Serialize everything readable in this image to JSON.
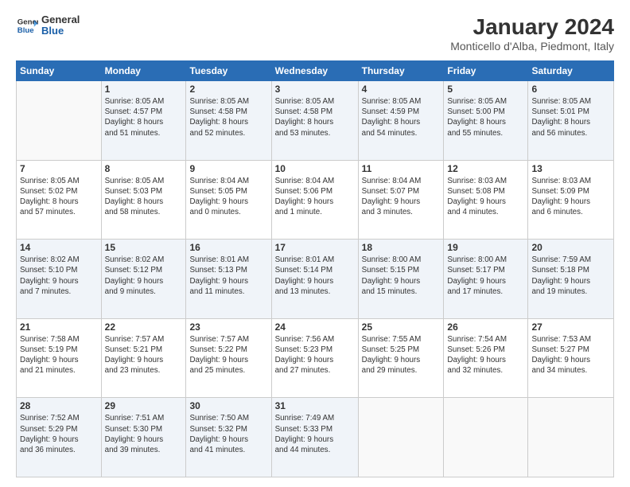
{
  "logo": {
    "line1": "General",
    "line2": "Blue"
  },
  "title": "January 2024",
  "subtitle": "Monticello d'Alba, Piedmont, Italy",
  "days_of_week": [
    "Sunday",
    "Monday",
    "Tuesday",
    "Wednesday",
    "Thursday",
    "Friday",
    "Saturday"
  ],
  "weeks": [
    [
      {
        "day": "",
        "content": ""
      },
      {
        "day": "1",
        "content": "Sunrise: 8:05 AM\nSunset: 4:57 PM\nDaylight: 8 hours\nand 51 minutes."
      },
      {
        "day": "2",
        "content": "Sunrise: 8:05 AM\nSunset: 4:58 PM\nDaylight: 8 hours\nand 52 minutes."
      },
      {
        "day": "3",
        "content": "Sunrise: 8:05 AM\nSunset: 4:58 PM\nDaylight: 8 hours\nand 53 minutes."
      },
      {
        "day": "4",
        "content": "Sunrise: 8:05 AM\nSunset: 4:59 PM\nDaylight: 8 hours\nand 54 minutes."
      },
      {
        "day": "5",
        "content": "Sunrise: 8:05 AM\nSunset: 5:00 PM\nDaylight: 8 hours\nand 55 minutes."
      },
      {
        "day": "6",
        "content": "Sunrise: 8:05 AM\nSunset: 5:01 PM\nDaylight: 8 hours\nand 56 minutes."
      }
    ],
    [
      {
        "day": "7",
        "content": "Sunrise: 8:05 AM\nSunset: 5:02 PM\nDaylight: 8 hours\nand 57 minutes."
      },
      {
        "day": "8",
        "content": "Sunrise: 8:05 AM\nSunset: 5:03 PM\nDaylight: 8 hours\nand 58 minutes."
      },
      {
        "day": "9",
        "content": "Sunrise: 8:04 AM\nSunset: 5:05 PM\nDaylight: 9 hours\nand 0 minutes."
      },
      {
        "day": "10",
        "content": "Sunrise: 8:04 AM\nSunset: 5:06 PM\nDaylight: 9 hours\nand 1 minute."
      },
      {
        "day": "11",
        "content": "Sunrise: 8:04 AM\nSunset: 5:07 PM\nDaylight: 9 hours\nand 3 minutes."
      },
      {
        "day": "12",
        "content": "Sunrise: 8:03 AM\nSunset: 5:08 PM\nDaylight: 9 hours\nand 4 minutes."
      },
      {
        "day": "13",
        "content": "Sunrise: 8:03 AM\nSunset: 5:09 PM\nDaylight: 9 hours\nand 6 minutes."
      }
    ],
    [
      {
        "day": "14",
        "content": "Sunrise: 8:02 AM\nSunset: 5:10 PM\nDaylight: 9 hours\nand 7 minutes."
      },
      {
        "day": "15",
        "content": "Sunrise: 8:02 AM\nSunset: 5:12 PM\nDaylight: 9 hours\nand 9 minutes."
      },
      {
        "day": "16",
        "content": "Sunrise: 8:01 AM\nSunset: 5:13 PM\nDaylight: 9 hours\nand 11 minutes."
      },
      {
        "day": "17",
        "content": "Sunrise: 8:01 AM\nSunset: 5:14 PM\nDaylight: 9 hours\nand 13 minutes."
      },
      {
        "day": "18",
        "content": "Sunrise: 8:00 AM\nSunset: 5:15 PM\nDaylight: 9 hours\nand 15 minutes."
      },
      {
        "day": "19",
        "content": "Sunrise: 8:00 AM\nSunset: 5:17 PM\nDaylight: 9 hours\nand 17 minutes."
      },
      {
        "day": "20",
        "content": "Sunrise: 7:59 AM\nSunset: 5:18 PM\nDaylight: 9 hours\nand 19 minutes."
      }
    ],
    [
      {
        "day": "21",
        "content": "Sunrise: 7:58 AM\nSunset: 5:19 PM\nDaylight: 9 hours\nand 21 minutes."
      },
      {
        "day": "22",
        "content": "Sunrise: 7:57 AM\nSunset: 5:21 PM\nDaylight: 9 hours\nand 23 minutes."
      },
      {
        "day": "23",
        "content": "Sunrise: 7:57 AM\nSunset: 5:22 PM\nDaylight: 9 hours\nand 25 minutes."
      },
      {
        "day": "24",
        "content": "Sunrise: 7:56 AM\nSunset: 5:23 PM\nDaylight: 9 hours\nand 27 minutes."
      },
      {
        "day": "25",
        "content": "Sunrise: 7:55 AM\nSunset: 5:25 PM\nDaylight: 9 hours\nand 29 minutes."
      },
      {
        "day": "26",
        "content": "Sunrise: 7:54 AM\nSunset: 5:26 PM\nDaylight: 9 hours\nand 32 minutes."
      },
      {
        "day": "27",
        "content": "Sunrise: 7:53 AM\nSunset: 5:27 PM\nDaylight: 9 hours\nand 34 minutes."
      }
    ],
    [
      {
        "day": "28",
        "content": "Sunrise: 7:52 AM\nSunset: 5:29 PM\nDaylight: 9 hours\nand 36 minutes."
      },
      {
        "day": "29",
        "content": "Sunrise: 7:51 AM\nSunset: 5:30 PM\nDaylight: 9 hours\nand 39 minutes."
      },
      {
        "day": "30",
        "content": "Sunrise: 7:50 AM\nSunset: 5:32 PM\nDaylight: 9 hours\nand 41 minutes."
      },
      {
        "day": "31",
        "content": "Sunrise: 7:49 AM\nSunset: 5:33 PM\nDaylight: 9 hours\nand 44 minutes."
      },
      {
        "day": "",
        "content": ""
      },
      {
        "day": "",
        "content": ""
      },
      {
        "day": "",
        "content": ""
      }
    ]
  ]
}
